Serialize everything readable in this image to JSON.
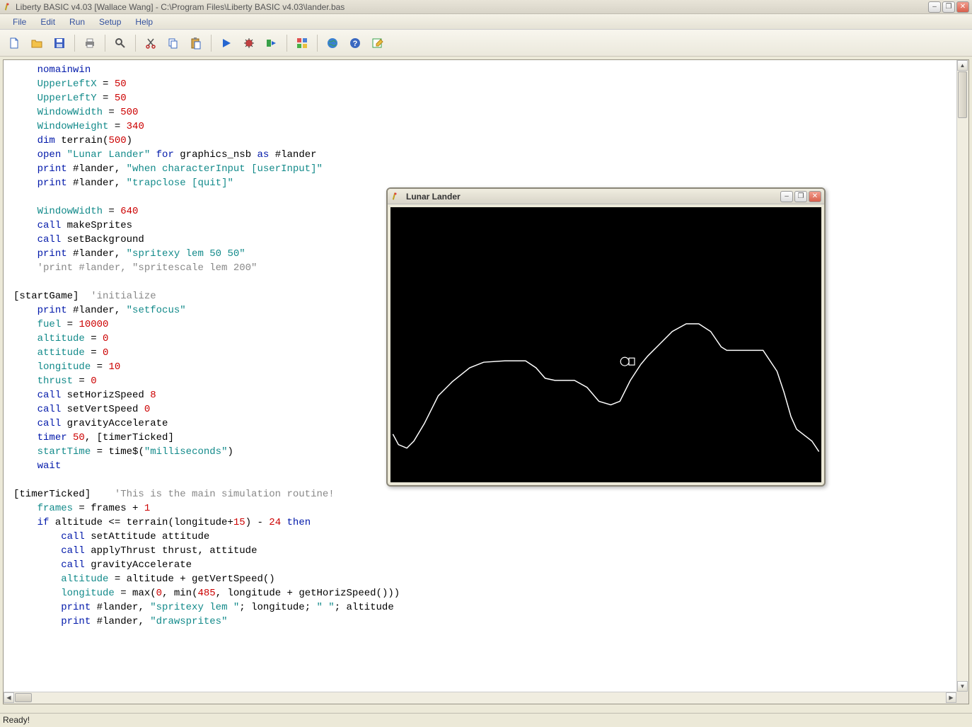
{
  "title": "Liberty BASIC v4.03 [Wallace Wang] - C:\\Program Files\\Liberty BASIC v4.03\\lander.bas",
  "menu": {
    "file": "File",
    "edit": "Edit",
    "run": "Run",
    "setup": "Setup",
    "help": "Help"
  },
  "toolbar_icons": [
    "new-file-icon",
    "open-file-icon",
    "save-icon",
    "sep",
    "print-icon",
    "sep",
    "find-icon",
    "sep",
    "cut-icon",
    "copy-icon",
    "paste-icon",
    "sep",
    "run-icon",
    "debug-icon",
    "run-to-icon",
    "sep",
    "form-icon",
    "sep",
    "world-icon",
    "help-icon",
    "edit-icon"
  ],
  "status": "Ready!",
  "lunar_title": "Lunar Lander",
  "code_lines": [
    {
      "indent": 2,
      "tokens": [
        [
          "blue",
          "nomainwin"
        ]
      ]
    },
    {
      "indent": 2,
      "tokens": [
        [
          "teal",
          "UpperLeftX"
        ],
        [
          "black",
          " = "
        ],
        [
          "num",
          "50"
        ]
      ]
    },
    {
      "indent": 2,
      "tokens": [
        [
          "teal",
          "UpperLeftY"
        ],
        [
          "black",
          " = "
        ],
        [
          "num",
          "50"
        ]
      ]
    },
    {
      "indent": 2,
      "tokens": [
        [
          "teal",
          "WindowWidth"
        ],
        [
          "black",
          " = "
        ],
        [
          "num",
          "500"
        ]
      ]
    },
    {
      "indent": 2,
      "tokens": [
        [
          "teal",
          "WindowHeight"
        ],
        [
          "black",
          " = "
        ],
        [
          "num",
          "340"
        ]
      ]
    },
    {
      "indent": 2,
      "tokens": [
        [
          "blue",
          "dim"
        ],
        [
          "black",
          " terrain("
        ],
        [
          "num",
          "500"
        ],
        [
          "black",
          ")"
        ]
      ]
    },
    {
      "indent": 2,
      "tokens": [
        [
          "blue",
          "open"
        ],
        [
          "black",
          " "
        ],
        [
          "str",
          "\"Lunar Lander\""
        ],
        [
          "black",
          " "
        ],
        [
          "blue",
          "for"
        ],
        [
          "black",
          " graphics_nsb "
        ],
        [
          "blue",
          "as"
        ],
        [
          "black",
          " #lander"
        ]
      ]
    },
    {
      "indent": 2,
      "tokens": [
        [
          "blue",
          "print"
        ],
        [
          "black",
          " #lander, "
        ],
        [
          "str",
          "\"when characterInput [userInput]\""
        ]
      ]
    },
    {
      "indent": 2,
      "tokens": [
        [
          "blue",
          "print"
        ],
        [
          "black",
          " #lander, "
        ],
        [
          "str",
          "\"trapclose [quit]\""
        ]
      ]
    },
    {
      "indent": 2,
      "tokens": []
    },
    {
      "indent": 2,
      "tokens": [
        [
          "teal",
          "WindowWidth"
        ],
        [
          "black",
          " = "
        ],
        [
          "num",
          "640"
        ]
      ]
    },
    {
      "indent": 2,
      "tokens": [
        [
          "blue",
          "call"
        ],
        [
          "black",
          " makeSprites"
        ]
      ]
    },
    {
      "indent": 2,
      "tokens": [
        [
          "blue",
          "call"
        ],
        [
          "black",
          " setBackground"
        ]
      ]
    },
    {
      "indent": 2,
      "tokens": [
        [
          "blue",
          "print"
        ],
        [
          "black",
          " #lander, "
        ],
        [
          "str",
          "\"spritexy lem 50 50\""
        ]
      ]
    },
    {
      "indent": 2,
      "tokens": [
        [
          "comment",
          "'print #lander, \"spritescale lem 200\""
        ]
      ]
    },
    {
      "indent": 0,
      "tokens": []
    },
    {
      "indent": 0,
      "tokens": [
        [
          "black",
          "[startGame]  "
        ],
        [
          "comment",
          "'initialize"
        ]
      ]
    },
    {
      "indent": 2,
      "tokens": [
        [
          "blue",
          "print"
        ],
        [
          "black",
          " #lander, "
        ],
        [
          "str",
          "\"setfocus\""
        ]
      ]
    },
    {
      "indent": 2,
      "tokens": [
        [
          "teal",
          "fuel"
        ],
        [
          "black",
          " = "
        ],
        [
          "num",
          "10000"
        ]
      ]
    },
    {
      "indent": 2,
      "tokens": [
        [
          "teal",
          "altitude"
        ],
        [
          "black",
          " = "
        ],
        [
          "num",
          "0"
        ]
      ]
    },
    {
      "indent": 2,
      "tokens": [
        [
          "teal",
          "attitude"
        ],
        [
          "black",
          " = "
        ],
        [
          "num",
          "0"
        ]
      ]
    },
    {
      "indent": 2,
      "tokens": [
        [
          "teal",
          "longitude"
        ],
        [
          "black",
          " = "
        ],
        [
          "num",
          "10"
        ]
      ]
    },
    {
      "indent": 2,
      "tokens": [
        [
          "teal",
          "thrust"
        ],
        [
          "black",
          " = "
        ],
        [
          "num",
          "0"
        ]
      ]
    },
    {
      "indent": 2,
      "tokens": [
        [
          "blue",
          "call"
        ],
        [
          "black",
          " setHorizSpeed "
        ],
        [
          "num",
          "8"
        ]
      ]
    },
    {
      "indent": 2,
      "tokens": [
        [
          "blue",
          "call"
        ],
        [
          "black",
          " setVertSpeed "
        ],
        [
          "num",
          "0"
        ]
      ]
    },
    {
      "indent": 2,
      "tokens": [
        [
          "blue",
          "call"
        ],
        [
          "black",
          " gravityAccelerate"
        ]
      ]
    },
    {
      "indent": 2,
      "tokens": [
        [
          "blue",
          "timer"
        ],
        [
          "black",
          " "
        ],
        [
          "num",
          "50"
        ],
        [
          "black",
          ", [timerTicked]"
        ]
      ]
    },
    {
      "indent": 2,
      "tokens": [
        [
          "teal",
          "startTime"
        ],
        [
          "black",
          " = time$("
        ],
        [
          "str",
          "\"milliseconds\""
        ],
        [
          "black",
          ")"
        ]
      ]
    },
    {
      "indent": 2,
      "tokens": [
        [
          "blue",
          "wait"
        ]
      ]
    },
    {
      "indent": 0,
      "tokens": []
    },
    {
      "indent": 0,
      "tokens": [
        [
          "black",
          "[timerTicked]    "
        ],
        [
          "comment",
          "'This is the main simulation routine!"
        ]
      ]
    },
    {
      "indent": 2,
      "tokens": [
        [
          "teal",
          "frames"
        ],
        [
          "black",
          " = frames + "
        ],
        [
          "num",
          "1"
        ]
      ]
    },
    {
      "indent": 2,
      "tokens": [
        [
          "blue",
          "if"
        ],
        [
          "black",
          " altitude <= terrain(longitude+"
        ],
        [
          "num",
          "15"
        ],
        [
          "black",
          ") - "
        ],
        [
          "num",
          "24"
        ],
        [
          "black",
          " "
        ],
        [
          "blue",
          "then"
        ]
      ]
    },
    {
      "indent": 4,
      "tokens": [
        [
          "blue",
          "call"
        ],
        [
          "black",
          " setAttitude attitude"
        ]
      ]
    },
    {
      "indent": 4,
      "tokens": [
        [
          "blue",
          "call"
        ],
        [
          "black",
          " applyThrust thrust, attitude"
        ]
      ]
    },
    {
      "indent": 4,
      "tokens": [
        [
          "blue",
          "call"
        ],
        [
          "black",
          " gravityAccelerate"
        ]
      ]
    },
    {
      "indent": 4,
      "tokens": [
        [
          "teal",
          "altitude"
        ],
        [
          "black",
          " = altitude + getVertSpeed()"
        ]
      ]
    },
    {
      "indent": 4,
      "tokens": [
        [
          "teal",
          "longitude"
        ],
        [
          "black",
          " = max("
        ],
        [
          "num",
          "0"
        ],
        [
          "black",
          ", min("
        ],
        [
          "num",
          "485"
        ],
        [
          "black",
          ", longitude + getHorizSpeed()))"
        ]
      ]
    },
    {
      "indent": 4,
      "tokens": [
        [
          "blue",
          "print"
        ],
        [
          "black",
          " #lander, "
        ],
        [
          "str",
          "\"spritexy lem \""
        ],
        [
          "black",
          "; longitude; "
        ],
        [
          "str",
          "\" \""
        ],
        [
          "black",
          "; altitude"
        ]
      ]
    },
    {
      "indent": 4,
      "tokens": [
        [
          "blue",
          "print"
        ],
        [
          "black",
          " #lander, "
        ],
        [
          "str",
          "\"drawsprites\""
        ]
      ]
    }
  ]
}
